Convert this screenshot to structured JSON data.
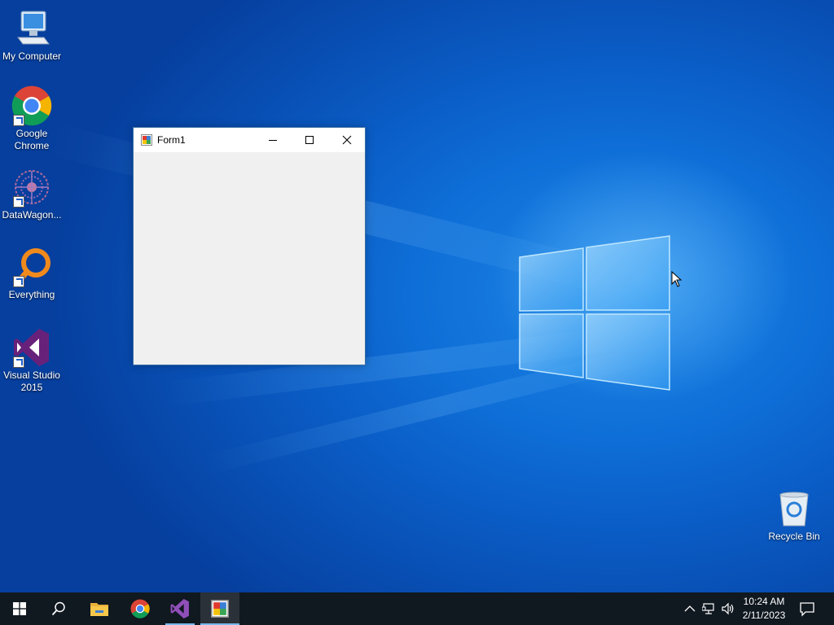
{
  "desktop": {
    "icons": [
      {
        "label": "My Computer",
        "icon": "computer-icon"
      },
      {
        "label": "Google Chrome",
        "icon": "chrome-icon"
      },
      {
        "label": "DataWagon...",
        "icon": "datawagon-icon"
      },
      {
        "label": "Everything",
        "icon": "everything-search-icon"
      },
      {
        "label": "Visual Studio 2015",
        "icon": "visual-studio-icon"
      },
      {
        "label": "Recycle Bin",
        "icon": "recycle-bin-icon"
      }
    ]
  },
  "window": {
    "title": "Form1",
    "icon": "winforms-app-icon",
    "controls": [
      "minimize-icon",
      "maximize-icon",
      "close-icon"
    ]
  },
  "taskbar": {
    "items": [
      {
        "icon": "windows-start-icon",
        "active": false
      },
      {
        "icon": "search-icon",
        "active": false
      },
      {
        "icon": "file-explorer-icon",
        "active": false
      },
      {
        "icon": "chrome-icon",
        "active": false
      },
      {
        "icon": "visual-studio-icon",
        "active": false,
        "running": true
      },
      {
        "icon": "winforms-app-icon",
        "active": true,
        "running": true
      }
    ],
    "tray": {
      "icons": [
        "chevron-up-icon",
        "network-icon",
        "volume-icon",
        "notification-icon"
      ],
      "time": "10:24 AM",
      "date": "2/11/2023"
    }
  },
  "colors": {
    "desktop_blue": "#0a5bc4",
    "taskbar": "#101820",
    "accent": "#76b9ed",
    "window_client": "#f0f0f0"
  }
}
